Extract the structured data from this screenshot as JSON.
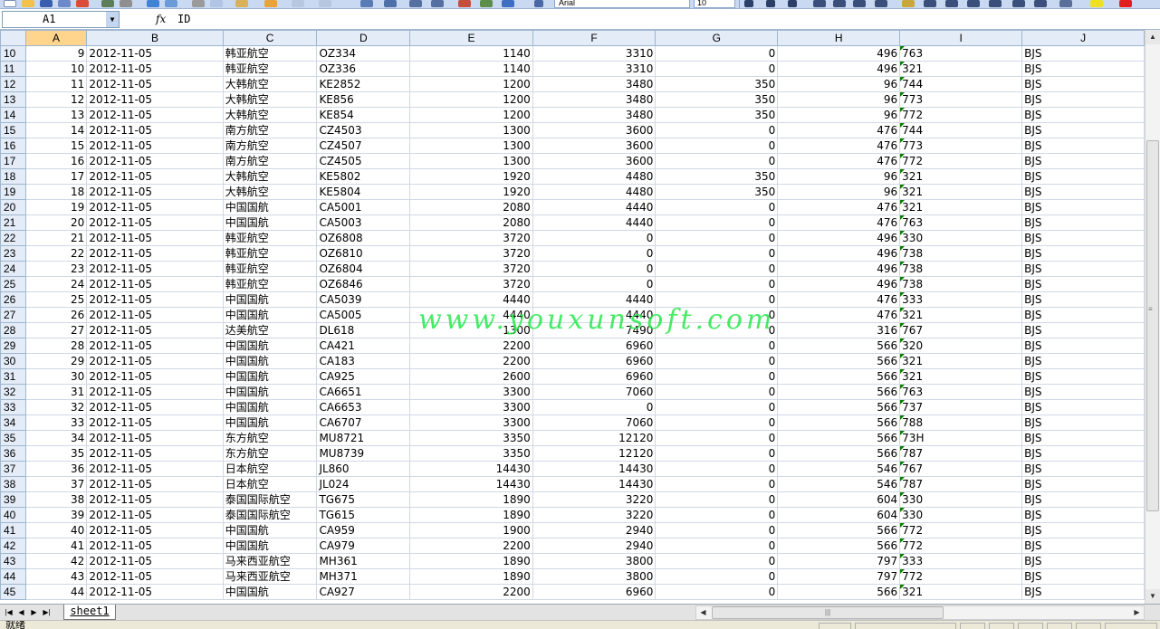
{
  "toolbar": {
    "font_name": "Arial",
    "font_size": "10"
  },
  "formula_bar": {
    "name_box": "A1",
    "fx_label": "fx",
    "content": "ID"
  },
  "columns": [
    "A",
    "B",
    "C",
    "D",
    "E",
    "F",
    "G",
    "H",
    "I",
    "J"
  ],
  "selected_column": "A",
  "rows": [
    {
      "n": "10",
      "cells": [
        "9",
        "2012-11-05",
        "韩亚航空",
        "OZ334",
        "1140",
        "3310",
        "0",
        "496",
        "763",
        "BJS"
      ]
    },
    {
      "n": "11",
      "cells": [
        "10",
        "2012-11-05",
        "韩亚航空",
        "OZ336",
        "1140",
        "3310",
        "0",
        "496",
        "321",
        "BJS"
      ]
    },
    {
      "n": "12",
      "cells": [
        "11",
        "2012-11-05",
        "大韩航空",
        "KE2852",
        "1200",
        "3480",
        "350",
        "96",
        "744",
        "BJS"
      ]
    },
    {
      "n": "13",
      "cells": [
        "12",
        "2012-11-05",
        "大韩航空",
        "KE856",
        "1200",
        "3480",
        "350",
        "96",
        "773",
        "BJS"
      ]
    },
    {
      "n": "14",
      "cells": [
        "13",
        "2012-11-05",
        "大韩航空",
        "KE854",
        "1200",
        "3480",
        "350",
        "96",
        "772",
        "BJS"
      ]
    },
    {
      "n": "15",
      "cells": [
        "14",
        "2012-11-05",
        "南方航空",
        "CZ4503",
        "1300",
        "3600",
        "0",
        "476",
        "744",
        "BJS"
      ]
    },
    {
      "n": "16",
      "cells": [
        "15",
        "2012-11-05",
        "南方航空",
        "CZ4507",
        "1300",
        "3600",
        "0",
        "476",
        "773",
        "BJS"
      ]
    },
    {
      "n": "17",
      "cells": [
        "16",
        "2012-11-05",
        "南方航空",
        "CZ4505",
        "1300",
        "3600",
        "0",
        "476",
        "772",
        "BJS"
      ]
    },
    {
      "n": "18",
      "cells": [
        "17",
        "2012-11-05",
        "大韩航空",
        "KE5802",
        "1920",
        "4480",
        "350",
        "96",
        "321",
        "BJS"
      ]
    },
    {
      "n": "19",
      "cells": [
        "18",
        "2012-11-05",
        "大韩航空",
        "KE5804",
        "1920",
        "4480",
        "350",
        "96",
        "321",
        "BJS"
      ]
    },
    {
      "n": "20",
      "cells": [
        "19",
        "2012-11-05",
        "中国国航",
        "CA5001",
        "2080",
        "4440",
        "0",
        "476",
        "321",
        "BJS"
      ]
    },
    {
      "n": "21",
      "cells": [
        "20",
        "2012-11-05",
        "中国国航",
        "CA5003",
        "2080",
        "4440",
        "0",
        "476",
        "763",
        "BJS"
      ]
    },
    {
      "n": "22",
      "cells": [
        "21",
        "2012-11-05",
        "韩亚航空",
        "OZ6808",
        "3720",
        "0",
        "0",
        "496",
        "330",
        "BJS"
      ]
    },
    {
      "n": "23",
      "cells": [
        "22",
        "2012-11-05",
        "韩亚航空",
        "OZ6810",
        "3720",
        "0",
        "0",
        "496",
        "738",
        "BJS"
      ]
    },
    {
      "n": "24",
      "cells": [
        "23",
        "2012-11-05",
        "韩亚航空",
        "OZ6804",
        "3720",
        "0",
        "0",
        "496",
        "738",
        "BJS"
      ]
    },
    {
      "n": "25",
      "cells": [
        "24",
        "2012-11-05",
        "韩亚航空",
        "OZ6846",
        "3720",
        "0",
        "0",
        "496",
        "738",
        "BJS"
      ]
    },
    {
      "n": "26",
      "cells": [
        "25",
        "2012-11-05",
        "中国国航",
        "CA5039",
        "4440",
        "4440",
        "0",
        "476",
        "333",
        "BJS"
      ]
    },
    {
      "n": "27",
      "cells": [
        "26",
        "2012-11-05",
        "中国国航",
        "CA5005",
        "4440",
        "4440",
        "0",
        "476",
        "321",
        "BJS"
      ]
    },
    {
      "n": "28",
      "cells": [
        "27",
        "2012-11-05",
        "达美航空",
        "DL618",
        "1300",
        "7490",
        "0",
        "316",
        "767",
        "BJS"
      ]
    },
    {
      "n": "29",
      "cells": [
        "28",
        "2012-11-05",
        "中国国航",
        "CA421",
        "2200",
        "6960",
        "0",
        "566",
        "320",
        "BJS"
      ]
    },
    {
      "n": "30",
      "cells": [
        "29",
        "2012-11-05",
        "中国国航",
        "CA183",
        "2200",
        "6960",
        "0",
        "566",
        "321",
        "BJS"
      ]
    },
    {
      "n": "31",
      "cells": [
        "30",
        "2012-11-05",
        "中国国航",
        "CA925",
        "2600",
        "6960",
        "0",
        "566",
        "321",
        "BJS"
      ]
    },
    {
      "n": "32",
      "cells": [
        "31",
        "2012-11-05",
        "中国国航",
        "CA6651",
        "3300",
        "7060",
        "0",
        "566",
        "763",
        "BJS"
      ]
    },
    {
      "n": "33",
      "cells": [
        "32",
        "2012-11-05",
        "中国国航",
        "CA6653",
        "3300",
        "0",
        "0",
        "566",
        "737",
        "BJS"
      ]
    },
    {
      "n": "34",
      "cells": [
        "33",
        "2012-11-05",
        "中国国航",
        "CA6707",
        "3300",
        "7060",
        "0",
        "566",
        "788",
        "BJS"
      ]
    },
    {
      "n": "35",
      "cells": [
        "34",
        "2012-11-05",
        "东方航空",
        "MU8721",
        "3350",
        "12120",
        "0",
        "566",
        "73H",
        "BJS"
      ]
    },
    {
      "n": "36",
      "cells": [
        "35",
        "2012-11-05",
        "东方航空",
        "MU8739",
        "3350",
        "12120",
        "0",
        "566",
        "787",
        "BJS"
      ]
    },
    {
      "n": "37",
      "cells": [
        "36",
        "2012-11-05",
        "日本航空",
        "JL860",
        "14430",
        "14430",
        "0",
        "546",
        "767",
        "BJS"
      ]
    },
    {
      "n": "38",
      "cells": [
        "37",
        "2012-11-05",
        "日本航空",
        "JL024",
        "14430",
        "14430",
        "0",
        "546",
        "787",
        "BJS"
      ]
    },
    {
      "n": "39",
      "cells": [
        "38",
        "2012-11-05",
        "泰国国际航空",
        "TG675",
        "1890",
        "3220",
        "0",
        "604",
        "330",
        "BJS"
      ]
    },
    {
      "n": "40",
      "cells": [
        "39",
        "2012-11-05",
        "泰国国际航空",
        "TG615",
        "1890",
        "3220",
        "0",
        "604",
        "330",
        "BJS"
      ]
    },
    {
      "n": "41",
      "cells": [
        "40",
        "2012-11-05",
        "中国国航",
        "CA959",
        "1900",
        "2940",
        "0",
        "566",
        "772",
        "BJS"
      ]
    },
    {
      "n": "42",
      "cells": [
        "41",
        "2012-11-05",
        "中国国航",
        "CA979",
        "2200",
        "2940",
        "0",
        "566",
        "772",
        "BJS"
      ]
    },
    {
      "n": "43",
      "cells": [
        "42",
        "2012-11-05",
        "马来西亚航空",
        "MH361",
        "1890",
        "3800",
        "0",
        "797",
        "333",
        "BJS"
      ]
    },
    {
      "n": "44",
      "cells": [
        "43",
        "2012-11-05",
        "马来西亚航空",
        "MH371",
        "1890",
        "3800",
        "0",
        "797",
        "772",
        "BJS"
      ]
    },
    {
      "n": "45",
      "cells": [
        "44",
        "2012-11-05",
        "中国国航",
        "CA927",
        "2200",
        "6960",
        "0",
        "566",
        "321",
        "BJS"
      ]
    }
  ],
  "sheet_tab": "sheet1",
  "status_text": "就绪",
  "watermark": "www.youxunsoft.com"
}
